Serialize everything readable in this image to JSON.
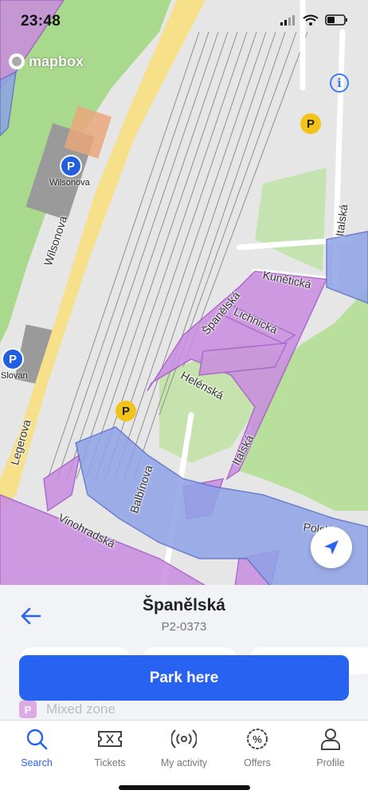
{
  "status": {
    "time": "23:48"
  },
  "map": {
    "attribution": "mapbox",
    "info_symbol": "i",
    "streets": [
      "Wilsonova",
      "Legerova",
      "Vinohradská",
      "Balbínova",
      "Italská",
      "Italská",
      "Španělská",
      "Kunětická",
      "Lichnická",
      "Helénská",
      "Polská"
    ],
    "pois": [
      {
        "label": "Wilsonova",
        "symbol": "P"
      },
      {
        "label": "Slovan",
        "symbol": "P"
      }
    ],
    "paid_parking_symbol": "P"
  },
  "zone": {
    "name": "Španělská",
    "code": "P2-0373",
    "type_badge": "P",
    "type_label": "Mixed zone",
    "primary_action": "Park here"
  },
  "tabs": [
    {
      "label": "Search",
      "icon": "search-icon",
      "active": true
    },
    {
      "label": "Tickets",
      "icon": "ticket-icon",
      "active": false
    },
    {
      "label": "My activity",
      "icon": "activity-icon",
      "active": false
    },
    {
      "label": "Offers",
      "icon": "offers-icon",
      "active": false
    },
    {
      "label": "Profile",
      "icon": "profile-icon",
      "active": false
    }
  ],
  "colors": {
    "primary": "#2762f0",
    "park_pin": "#1f5fe0",
    "paid_pin": "#f3c319",
    "zone_purple": "#c98ce0",
    "zone_blue": "#8fa2e6",
    "park_green": "#a8d88a"
  }
}
